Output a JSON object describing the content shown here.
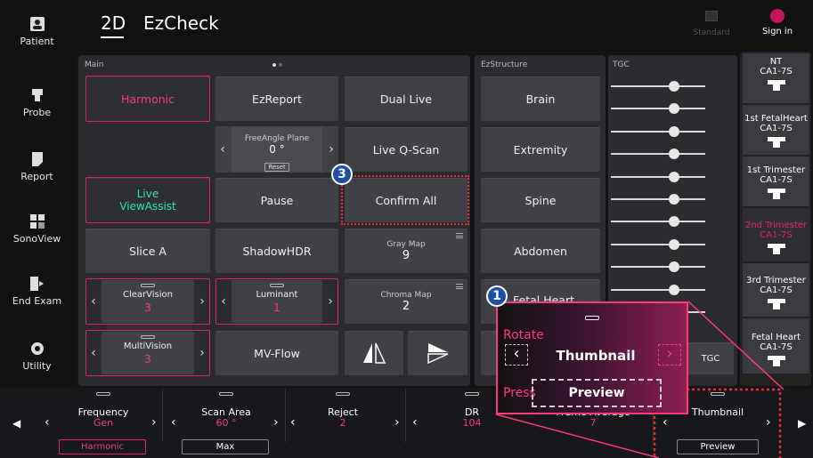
{
  "left_nav": [
    {
      "label": "Patient",
      "icon": "patient-icon"
    },
    {
      "label": "Probe",
      "icon": "probe-icon"
    },
    {
      "label": "Report",
      "icon": "report-icon"
    },
    {
      "label": "SonoView",
      "icon": "sonoview-icon"
    },
    {
      "label": "End Exam",
      "icon": "end-exam-icon"
    },
    {
      "label": "Utility",
      "icon": "gear-icon"
    }
  ],
  "header": {
    "mode_tab": "2D",
    "ezcheck_tab": "EzCheck",
    "standard_label": "Standard",
    "signin_label": "Sign in"
  },
  "main_panel": {
    "title": "Main",
    "buttons": {
      "harmonic": "Harmonic",
      "ezreport": "EzReport",
      "dual_live": "Dual Live",
      "freeangle_label": "FreeAngle Plane",
      "freeangle_value": "0 °",
      "freeangle_reset": "Reset",
      "live_qscan": "Live Q-Scan",
      "live_label": "Live",
      "viewassist_label": "ViewAssist",
      "pause": "Pause",
      "confirm_all": "Confirm All",
      "slice_a": "Slice A",
      "shadowhdr": "ShadowHDR",
      "gray_map_label": "Gray Map",
      "gray_map_value": "9",
      "clearvision_label": "ClearVision",
      "clearvision_value": "3",
      "luminant_label": "Luminant",
      "luminant_value": "1",
      "chroma_map_label": "Chroma Map",
      "chroma_map_value": "2",
      "multivision_label": "MultiVision",
      "multivision_value": "3",
      "mvflow": "MV-Flow"
    }
  },
  "ezstructure_panel": {
    "title": "EzStructure",
    "items": [
      "Brain",
      "Extremity",
      "Spine",
      "Abdomen",
      "Fetal Heart"
    ]
  },
  "tgc_panel": {
    "title": "TGC",
    "button": "TGC",
    "slider_levels": [
      0.67,
      0.67,
      0.67,
      0.67,
      0.67,
      0.67,
      0.67,
      0.67,
      0.67,
      0.67,
      0.67
    ]
  },
  "probe_list": [
    {
      "preset": "NT",
      "probe": "CA1-7S",
      "active": false
    },
    {
      "preset": "1st FetalHeart",
      "probe": "CA1-7S",
      "active": false
    },
    {
      "preset": "1st Trimester",
      "probe": "CA1-7S",
      "active": false
    },
    {
      "preset": "2nd Trimester",
      "probe": "CA1-7S",
      "active": true
    },
    {
      "preset": "3rd Trimester",
      "probe": "CA1-7S",
      "active": false
    },
    {
      "preset": "Fetal Heart",
      "probe": "CA1-7S",
      "active": false
    }
  ],
  "bottom_bar": {
    "frequency_label": "Frequency",
    "frequency_value": "Gen",
    "frequency_button": "Harmonic",
    "scan_area_label": "Scan Area",
    "scan_area_value": "60 °",
    "scan_area_button": "Max",
    "reject_label": "Reject",
    "reject_value": "2",
    "dr_label": "DR",
    "dr_value": "104",
    "frame_average_label": "Frame Average",
    "frame_average_value": "7",
    "thumbnail_label": "Thumbnail",
    "thumbnail_button": "Preview"
  },
  "callouts": {
    "badge1": "1",
    "badge3": "3",
    "zoom_rotate": "Rotate",
    "zoom_title": "Thumbnail",
    "zoom_press": "Press",
    "zoom_preview": "Preview"
  },
  "colors": {
    "accent": "#e0246f",
    "badge_blue": "#1d4fa8",
    "callout_red": "#e0303a"
  }
}
